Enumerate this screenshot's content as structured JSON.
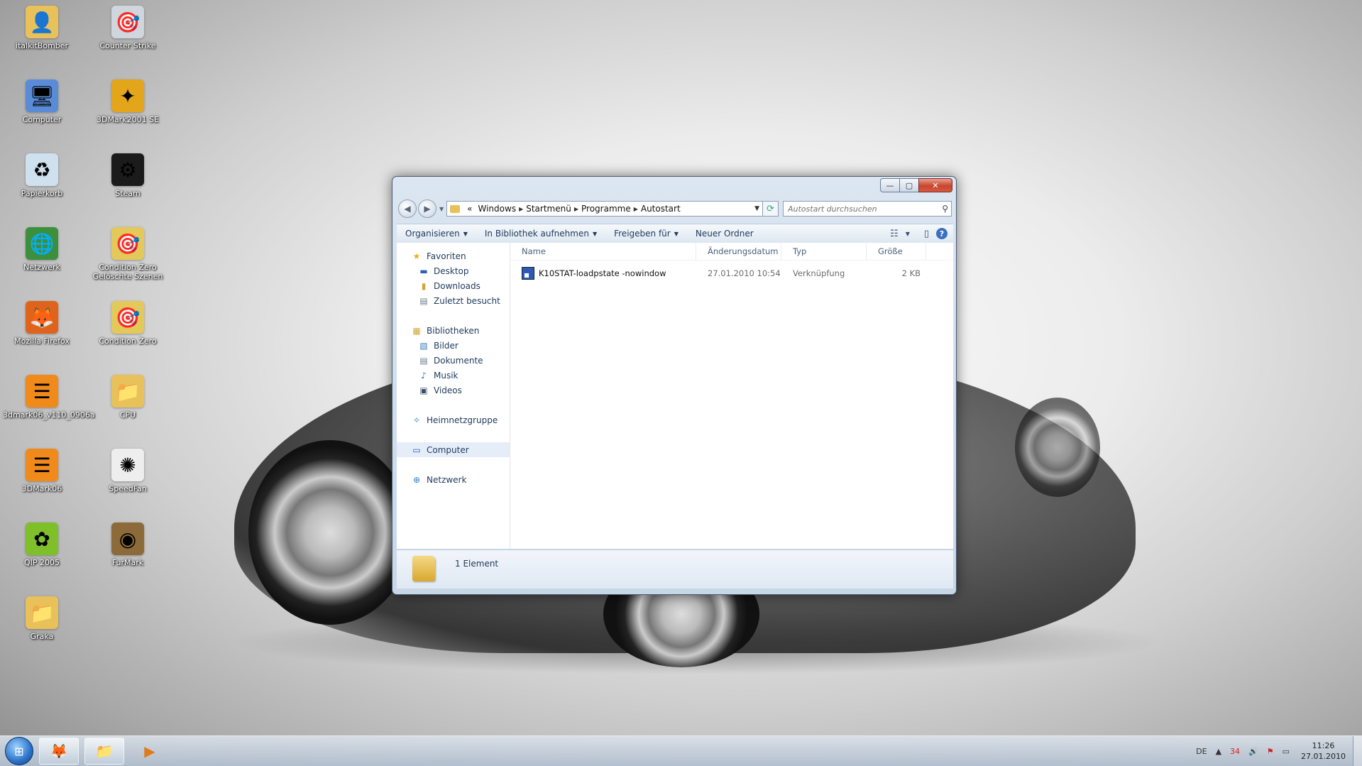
{
  "desktop_icons": [
    {
      "label": "italkitBomber",
      "glyph": "👤",
      "color": "#e9c15a"
    },
    {
      "label": "Counter Strike",
      "glyph": "🎯",
      "color": "#cfd6dd"
    },
    {
      "label": "Computer",
      "glyph": "🖥",
      "color": "#5a8bd6"
    },
    {
      "label": "3DMark2001 SE",
      "glyph": "✦",
      "color": "#e3a51a"
    },
    {
      "label": "Papierkorb",
      "glyph": "♻",
      "color": "#cfe0ef"
    },
    {
      "label": "Steam",
      "glyph": "⚙",
      "color": "#1b1b1b"
    },
    {
      "label": "Netzwerk",
      "glyph": "🌐",
      "color": "#3c8f3c"
    },
    {
      "label": "Condition Zero Gelöschte Szenen",
      "glyph": "🎯",
      "color": "#e3c85a"
    },
    {
      "label": "Mozilla Firefox",
      "glyph": "🦊",
      "color": "#e0631b"
    },
    {
      "label": "Condition Zero",
      "glyph": "🎯",
      "color": "#e3c85a"
    },
    {
      "label": "3dmark06_v110_0906a",
      "glyph": "☰",
      "color": "#f08a1a"
    },
    {
      "label": "CPU",
      "glyph": "📁",
      "color": "#e9c15a"
    },
    {
      "label": "3DMark06",
      "glyph": "☰",
      "color": "#f08a1a"
    },
    {
      "label": "SpeedFan",
      "glyph": "✺",
      "color": "#eeeeee"
    },
    {
      "label": "QIP 2005",
      "glyph": "✿",
      "color": "#7fbf2a"
    },
    {
      "label": "FurMark",
      "glyph": "◉",
      "color": "#8c6a3a"
    },
    {
      "label": "Graka",
      "glyph": "📁",
      "color": "#e9c15a"
    }
  ],
  "window": {
    "caption": {
      "minimize": "—",
      "maximize": "▢",
      "close": "✕"
    },
    "nav": {
      "back": "◀",
      "forward": "▶",
      "dropdown": "▼"
    },
    "address": {
      "prefix": "«",
      "crumbs": [
        "Windows",
        "Startmenü",
        "Programme",
        "Autostart"
      ],
      "separator": "▶",
      "dropdown": "▼",
      "refresh": "⟳"
    },
    "search": {
      "placeholder": "Autostart durchsuchen",
      "icon": "⚲"
    },
    "toolbar": {
      "organize": "Organisieren",
      "library": "In Bibliothek aufnehmen",
      "share": "Freigeben für",
      "new_folder": "Neuer Ordner",
      "arrow": "▼",
      "view_icon": "☷",
      "view_arrow": "▼",
      "preview_icon": "▯",
      "help": "?"
    },
    "navpane": {
      "favorites": {
        "label": "Favoriten",
        "icon": "★",
        "items": [
          {
            "label": "Desktop",
            "icon": "▬"
          },
          {
            "label": "Downloads",
            "icon": "▮"
          },
          {
            "label": "Zuletzt besucht",
            "icon": "▤"
          }
        ]
      },
      "libraries": {
        "label": "Bibliotheken",
        "icon": "▦",
        "items": [
          {
            "label": "Bilder",
            "icon": "▧"
          },
          {
            "label": "Dokumente",
            "icon": "▤"
          },
          {
            "label": "Musik",
            "icon": "♪"
          },
          {
            "label": "Videos",
            "icon": "▣"
          }
        ]
      },
      "homegroup": {
        "label": "Heimnetzgruppe",
        "icon": "✧"
      },
      "computer": {
        "label": "Computer",
        "icon": "▭"
      },
      "network": {
        "label": "Netzwerk",
        "icon": "⊕"
      }
    },
    "columns": {
      "name": "Name",
      "date": "Änderungsdatum",
      "type": "Typ",
      "size": "Größe"
    },
    "files": [
      {
        "name": "K10STAT-loadpstate -nowindow",
        "date": "27.01.2010 10:54",
        "type": "Verknüpfung",
        "size": "2 KB"
      }
    ],
    "status": {
      "count": "1 Element"
    }
  },
  "taskbar": {
    "start_icon": "⊞",
    "buttons": [
      {
        "name": "firefox",
        "glyph": "🦊"
      },
      {
        "name": "explorer",
        "glyph": "📁"
      },
      {
        "name": "media-player",
        "glyph": "▶"
      }
    ],
    "tray": {
      "lang": "DE",
      "arrow": "▲",
      "temp": "34",
      "volume": "🔊",
      "flag": "⚑",
      "network": "▭"
    },
    "clock": {
      "time": "11:26",
      "date": "27.01.2010"
    }
  }
}
